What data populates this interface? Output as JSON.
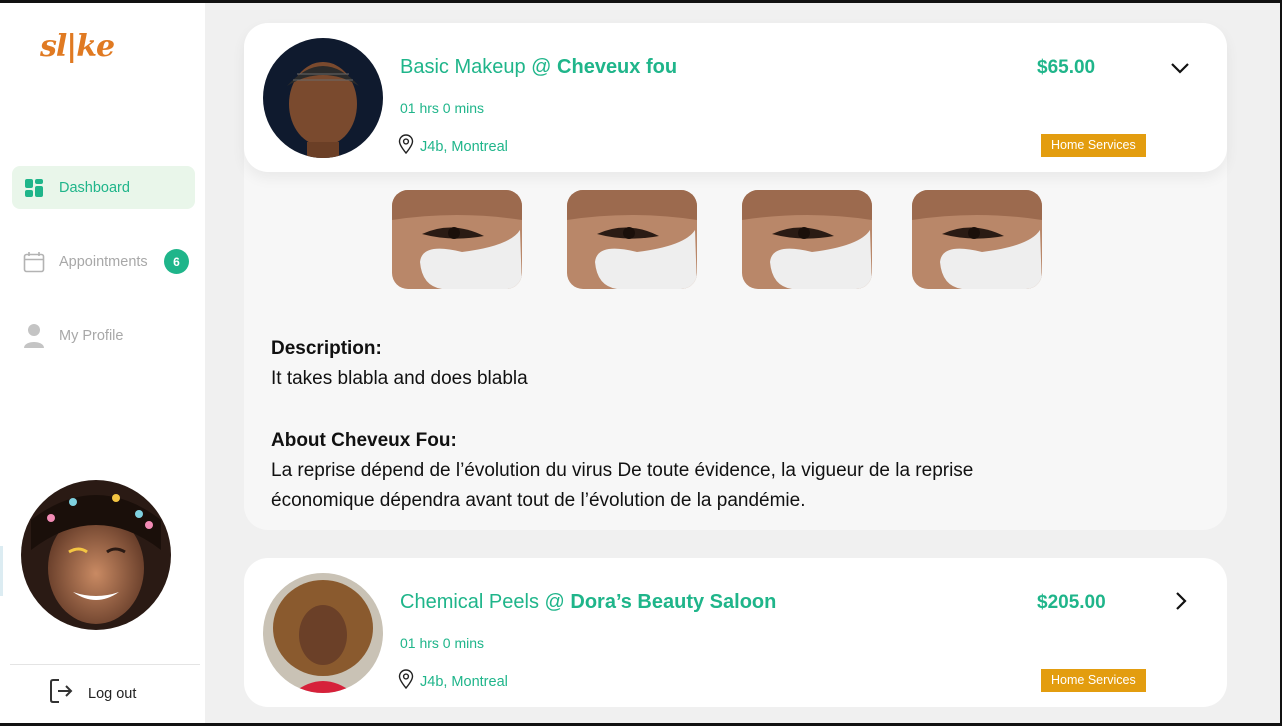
{
  "app": {
    "logo": "sl|ke"
  },
  "sidebar": {
    "items": [
      {
        "label": "Dashboard",
        "icon": "dashboard-icon",
        "active": true
      },
      {
        "label": "Appointments",
        "icon": "calendar-icon",
        "badge": "6"
      },
      {
        "label": "My Profile",
        "icon": "user-icon"
      }
    ],
    "logout_label": "Log out"
  },
  "appointments": [
    {
      "service": "Basic Makeup @ ",
      "salon": "Cheveux fou",
      "duration": "01 hrs 0 mins",
      "location": "J4b, Montreal",
      "price": "$65.00",
      "tag": "Home Services",
      "expanded": true,
      "description_heading": "Description:",
      "description": "It takes blabla and does blabla",
      "about_heading": "About Cheveux Fou:",
      "about_line1": "La reprise dépend de l’évolution du virus De toute évidence, la vigueur de la reprise",
      "about_line2": "économique dépendra avant tout de l’évolution de la pandémie."
    },
    {
      "service": "Chemical Peels @ ",
      "salon": "Dora’s Beauty Saloon",
      "duration": "01 hrs 0 mins",
      "location": "J4b, Montreal",
      "price": "$205.00",
      "tag": "Home Services",
      "expanded": false
    }
  ],
  "colors": {
    "accent": "#1fb58a",
    "brand": "#e07a22",
    "tag": "#e39d0f"
  }
}
